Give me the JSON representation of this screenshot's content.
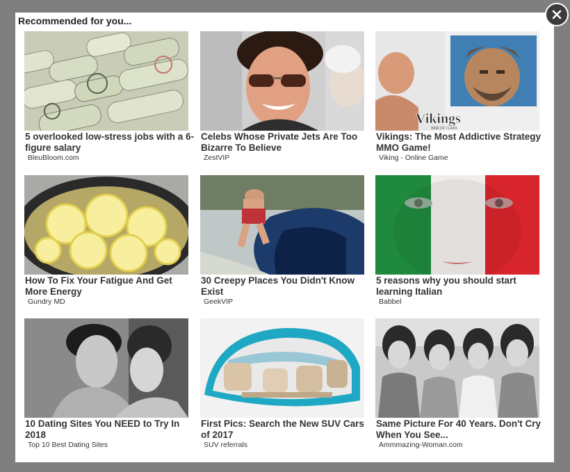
{
  "widget": {
    "title": "Recommended for you...",
    "close_icon": "close-icon"
  },
  "cards": [
    {
      "headline": "5 overlooked low-stress jobs with a 6-figure salary",
      "source": "BleuBloom.com"
    },
    {
      "headline": "Celebs Whose Private Jets Are Too Bizarre To Believe",
      "source": "ZestVIP"
    },
    {
      "headline": "Vikings: The Most Addictive Strategy MMO Game!",
      "source": "Viking - Online Game",
      "image_text": "Vikings",
      "image_subtext": "WAR OF CLANS"
    },
    {
      "headline": "How To Fix Your Fatigue And Get More Energy",
      "source": "Gundry MD"
    },
    {
      "headline": "30 Creepy Places You Didn't Know Exist",
      "source": "GeekVIP"
    },
    {
      "headline": "5 reasons why you should start learning Italian",
      "source": "Babbel"
    },
    {
      "headline": "10 Dating Sites You NEED to Try In 2018",
      "source": "Top 10 Best Dating Sites"
    },
    {
      "headline": "First Pics: Search the New SUV Cars of 2017",
      "source": "SUV referrals"
    },
    {
      "headline": "Same Picture For 40 Years. Don't Cry When You See...",
      "source": "Ammmazing-Woman.com"
    }
  ]
}
